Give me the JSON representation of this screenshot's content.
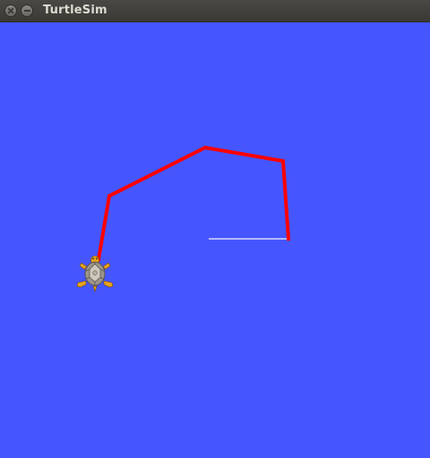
{
  "window": {
    "title": "TurtleSim",
    "buttons": [
      "close-icon",
      "minimize-icon"
    ]
  },
  "colors": {
    "background": "#4556FF",
    "pen": "#FF0000",
    "initial_pen": "#B3B8FF",
    "titlebar": "#3f3e3a",
    "title_text": "#dfdbd2"
  },
  "turtle": {
    "icon": "turtle-icon"
  }
}
